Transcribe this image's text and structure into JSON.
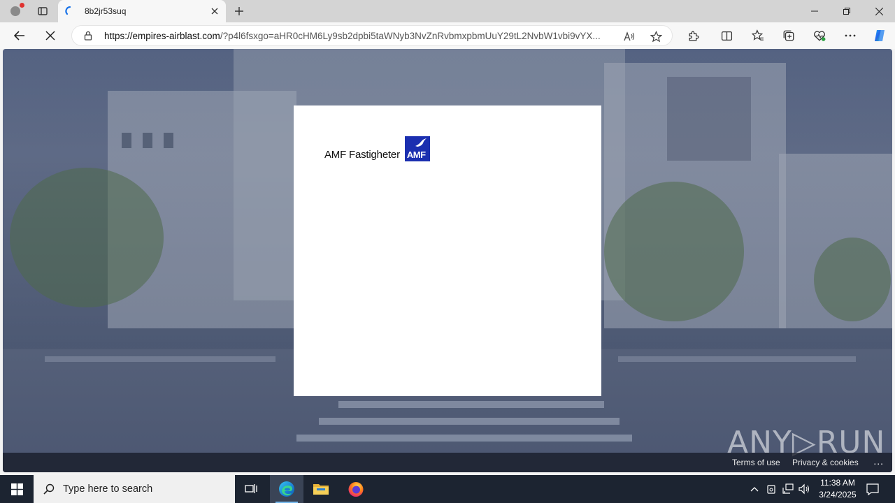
{
  "browser": {
    "tab": {
      "title": "8b2jr53suq"
    },
    "address": {
      "host": "https://empires-airblast.com",
      "path": "/?p4l6fsxgo=aHR0cHM6Ly9sb2dpbi5taWNyb3NvZnRvbmxpbmUuY29tL2NvbW1vbi9vYX..."
    }
  },
  "page": {
    "brand_name": "AMF Fastigheter",
    "logo_text": "AMF",
    "footer": {
      "terms": "Terms of use",
      "privacy": "Privacy & cookies",
      "more": "..."
    },
    "watermark": "ANY▷RUN"
  },
  "taskbar": {
    "search_placeholder": "Type here to search",
    "time": "11:38 AM",
    "date": "3/24/2025"
  },
  "colors": {
    "logo_blue": "#1b2fb0",
    "taskbar": "#1c2431"
  }
}
